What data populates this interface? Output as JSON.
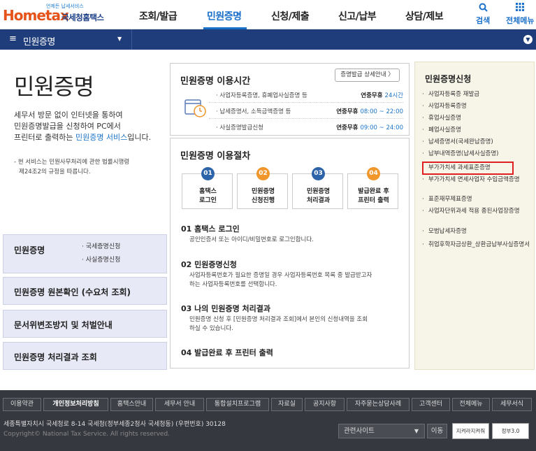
{
  "header": {
    "logo_tagline": "언제든 납세서비스",
    "logo_en": "Hometax",
    "logo_ko": "국세청홈택스",
    "nav": [
      "조회/발급",
      "민원증명",
      "신청/제출",
      "신고/납부",
      "상담/제보"
    ],
    "search_label": "검색",
    "allmenu_label": "전체메뉴"
  },
  "bar": {
    "title": "민원증명"
  },
  "left": {
    "title": "민원증명",
    "desc_1": "세무서 방문 없이 인터넷을 통하여",
    "desc_2": "민원증명발급을 신청하여 PC에서",
    "desc_3a": "프린터로 출력하는 ",
    "desc_3b": "민원증명 서비스",
    "desc_3c": "입니다.",
    "note_1": "- 현 서비스는 민원사무처리에 관한 법률시행령",
    "note_2": "제24조2의 규정을 따릅니다.",
    "boxes": [
      {
        "title": "민원증명",
        "subs": [
          "· 국세증명신청",
          "· 사실증명신청"
        ]
      },
      {
        "title": "민원증명 원본확인 (수요처 조회)"
      },
      {
        "title": "문서위변조방지 및 처벌안내"
      },
      {
        "title": "민원증명 처리결과 조회"
      }
    ]
  },
  "time": {
    "title": "민원증명 이용시간",
    "detail_button": "증명발급 상세안내 〉",
    "rows": [
      {
        "k": "· 사업자등록증명, 휴폐업사실증명 등",
        "v1": "연중무휴 ",
        "v2": "24시간"
      },
      {
        "k": "· 납세증명서, 소득금액증명 등",
        "v1": "연중무휴 ",
        "v2": "08:00 ~ 22:00"
      },
      {
        "k": "· 사실증명발급신청",
        "v1": "연중무휴 ",
        "v2": "09:00 ~ 24:00"
      }
    ]
  },
  "proc": {
    "title": "민원증명 이용절차",
    "steps": [
      {
        "n": "01",
        "l1": "홈택스",
        "l2": "로그인",
        "color": "#2d63a8"
      },
      {
        "n": "02",
        "l1": "민원증명",
        "l2": "신청진행",
        "color": "#f0962a"
      },
      {
        "n": "03",
        "l1": "민원증명",
        "l2": "처리결과",
        "color": "#2d63a8"
      },
      {
        "n": "04",
        "l1": "발급완료 후",
        "l2": "프린터 출력",
        "color": "#f0962a"
      }
    ],
    "items": [
      {
        "t": "01 홈택스 로그인",
        "d": [
          "공인인증서 또는 아이디/비밀번호로 로그인합니다."
        ]
      },
      {
        "t": "02 민원증명신청",
        "d": [
          "사업자등록번호가 필요한 증명일 경우 사업자등록번호 목록 중 발급받고자",
          "하는 사업자등록번호를 선택합니다."
        ]
      },
      {
        "t": "03 나의 민원증명 처리결과",
        "d": [
          "민원증명 신청 후 [민원증명 처리결과 조회]에서 본인의 신청내역을 조회",
          "하실 수 있습니다."
        ]
      },
      {
        "t": "04 발급완료 후 프린터 출력",
        "d": []
      }
    ]
  },
  "right": {
    "title": "민원증명신청",
    "items": [
      "사업자등록증 재발급",
      "사업자등록증명",
      "휴업사실증명",
      "폐업사실증명",
      "납세증명서(국세완납증명)",
      "납부내역증명(납세사실증명)",
      "부가가치세 과세표준증명",
      "부가가치세 면세사업자 수입금액증명",
      "표준재무제표증명",
      "사업자단위과세 적용 종된사업장증명",
      "모범납세자증명",
      "취업후학자금상환_상환금납부사실증명서"
    ]
  },
  "footer": {
    "links": [
      "이용약관",
      "개인정보처리방침",
      "홈택스안내",
      "세무서 안내",
      "통합설치프로그램",
      "자료실",
      "공지사항",
      "자주묻는상담사례",
      "고객센터",
      "전체메뉴",
      "세무서식"
    ],
    "address": "세종특별자치시 국세청로 8-14 국세청(정부세종2청사 국세청동) (우편번호) 30128",
    "copyright": "Copyright© National Tax Service. All rights reserved.",
    "related_site": "관련사이트",
    "go": "이동",
    "badge1": "지켜라지켜줘",
    "badge2": "정부3.0"
  },
  "colors": {
    "primary": "#1a6fc9",
    "bar": "#1f3d7a",
    "highlight": "#e02020"
  }
}
